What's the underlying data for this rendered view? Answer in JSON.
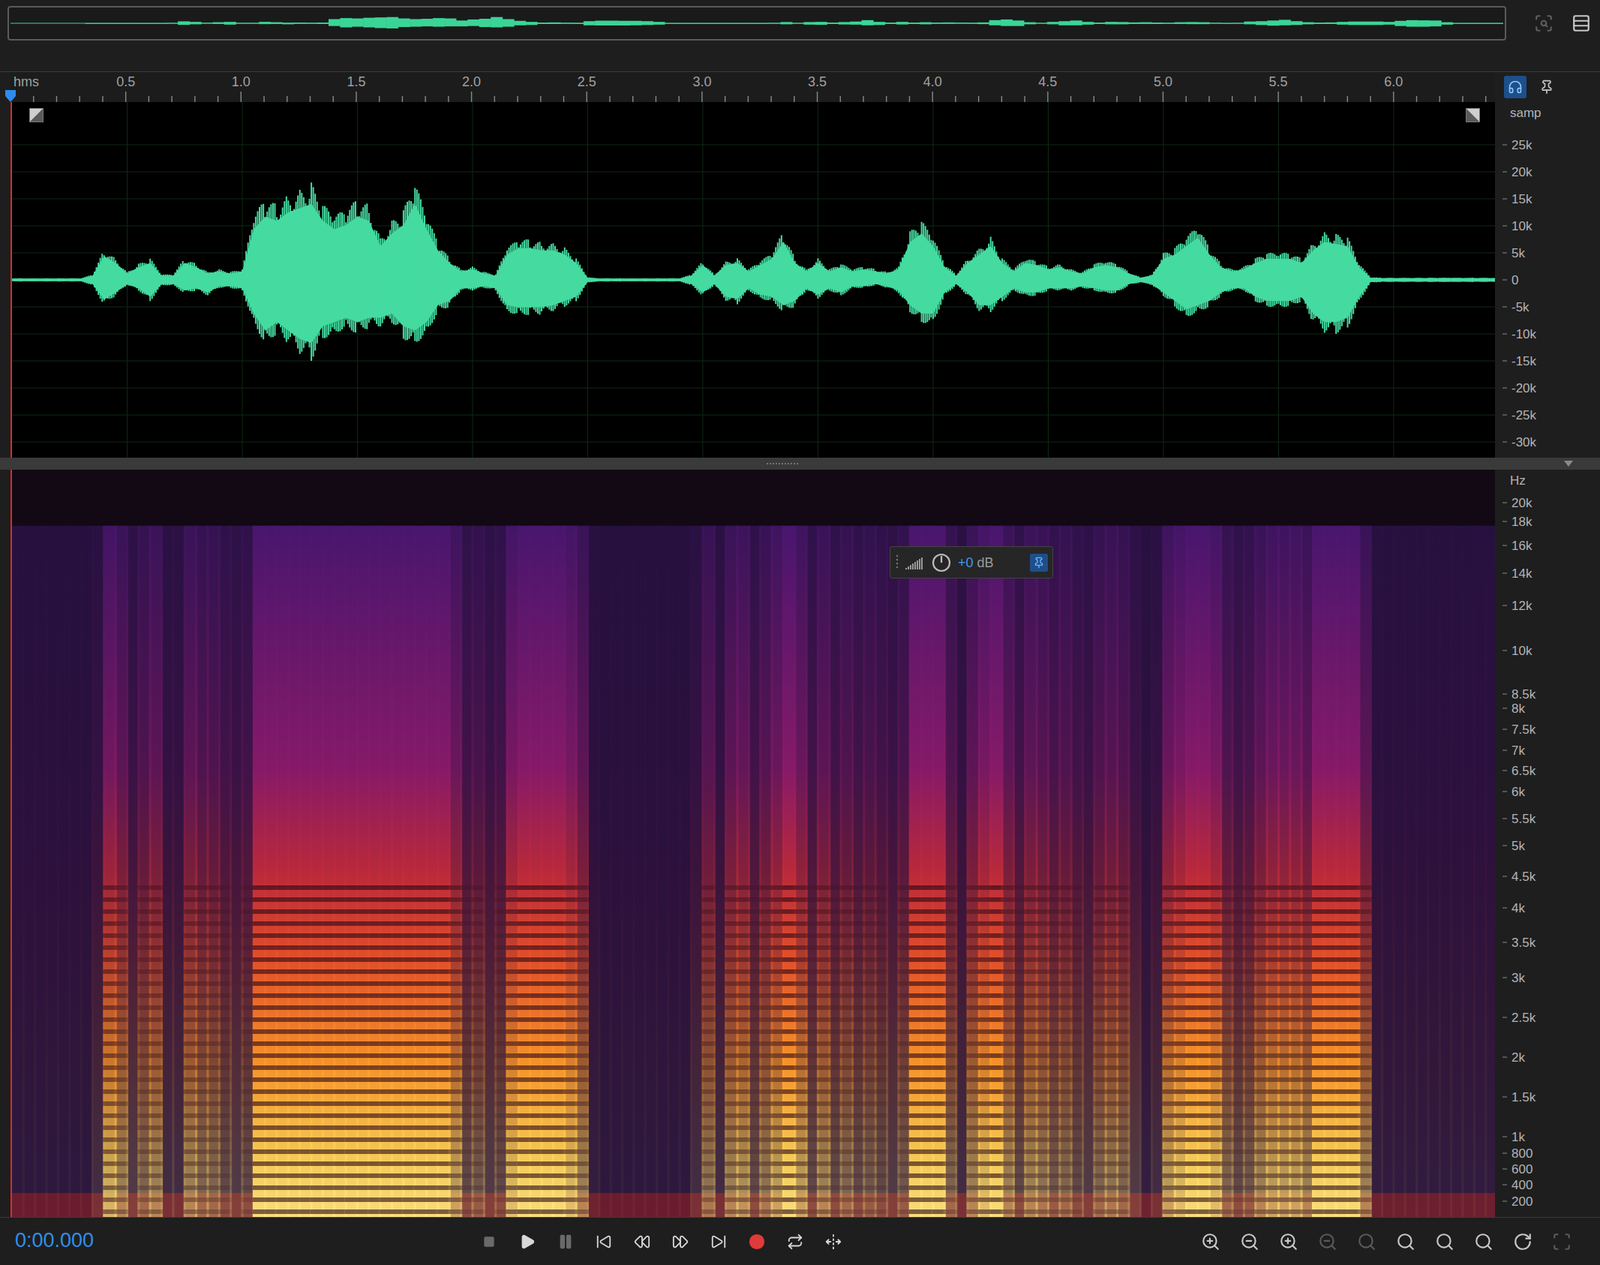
{
  "overview_tools": [
    {
      "kind": "zoom-navigator",
      "disabled": true
    },
    {
      "kind": "panel-menu",
      "disabled": false
    }
  ],
  "ruler": {
    "unit": "hms",
    "ticks": [
      "0.5",
      "1.0",
      "1.5",
      "2.0",
      "2.5",
      "3.0",
      "3.5",
      "4.0",
      "4.5",
      "5.0",
      "5.5",
      "6.0"
    ]
  },
  "ruler_tools": [
    {
      "kind": "headphones",
      "selected": true
    },
    {
      "kind": "pin",
      "selected": false
    }
  ],
  "waveform": {
    "axis_unit": "samp",
    "axis_ticks": [
      "25k",
      "20k",
      "15k",
      "10k",
      "5k",
      "0",
      "-5k",
      "-10k",
      "-15k",
      "-20k",
      "-25k",
      "-30k"
    ],
    "max": [
      300,
      300,
      300,
      300,
      300,
      300,
      300,
      1000,
      5600,
      4000,
      1500,
      3000,
      4000,
      1000,
      1000,
      4000,
      3000,
      1500,
      2000,
      1500,
      2000,
      12000,
      15000,
      14000,
      16000,
      17000,
      18000,
      14000,
      12000,
      13000,
      15000,
      14000,
      8000,
      11000,
      13000,
      18000,
      12000,
      7000,
      4000,
      2000,
      2500,
      1500,
      1000,
      6000,
      7500,
      7500,
      7000,
      7000,
      6000,
      4000,
      500,
      300,
      300,
      300,
      300,
      300,
      300,
      300,
      300,
      1000,
      3500,
      1000,
      3500,
      4000,
      2000,
      3500,
      5000,
      9000,
      4000,
      2000,
      4000,
      2000,
      3000,
      2000,
      2500,
      2000,
      1500,
      2500,
      9000,
      11000,
      8000,
      3000,
      1000,
      4000,
      6000,
      8000,
      4000,
      2000,
      4000,
      3500,
      2500,
      3000,
      2000,
      1500,
      3000,
      3500,
      3000,
      1500,
      500,
      1000,
      5000,
      6000,
      8000,
      10000,
      6000,
      3000,
      2000,
      2500,
      4000,
      5000,
      5000,
      5000,
      4000,
      7000,
      9000,
      8500,
      8000,
      3000,
      500,
      400,
      400,
      400,
      400,
      400,
      400,
      400,
      400,
      400,
      400
    ],
    "min": [
      -300,
      -300,
      -300,
      -300,
      -300,
      -300,
      -300,
      -1000,
      -4700,
      -3000,
      -1000,
      -2000,
      -4000,
      -1000,
      -1000,
      -2500,
      -2000,
      -3000,
      -1500,
      -1500,
      -2000,
      -8000,
      -12000,
      -10000,
      -12000,
      -14000,
      -15000,
      -11000,
      -10000,
      -9000,
      -10000,
      -9000,
      -9000,
      -8000,
      -11000,
      -12000,
      -10000,
      -6000,
      -5000,
      -2000,
      -2000,
      -1500,
      -2000,
      -6000,
      -6500,
      -6500,
      -6500,
      -6000,
      -5000,
      -4000,
      -500,
      -300,
      -300,
      -300,
      -300,
      -300,
      -300,
      -300,
      -300,
      -1000,
      -3000,
      -1000,
      -4000,
      -4500,
      -2000,
      -3500,
      -4000,
      -6000,
      -5000,
      -2000,
      -3500,
      -2000,
      -3000,
      -1500,
      -1500,
      -1000,
      -1500,
      -2500,
      -6000,
      -8000,
      -8000,
      -3000,
      -1000,
      -3000,
      -6000,
      -6000,
      -4000,
      -2000,
      -3000,
      -3000,
      -2000,
      -2000,
      -2000,
      -1500,
      -2000,
      -2500,
      -2500,
      -1000,
      -500,
      -1000,
      -3000,
      -5000,
      -7000,
      -6000,
      -5000,
      -3000,
      -2000,
      -2000,
      -4000,
      -5000,
      -5000,
      -5000,
      -4000,
      -8000,
      -10000,
      -10000,
      -9000,
      -4000,
      -500,
      -400,
      -400,
      -400,
      -400,
      -400,
      -400,
      -400,
      -400,
      -400,
      -400
    ]
  },
  "spectrogram": {
    "axis_unit": "Hz",
    "axis_ticks": [
      "20k",
      "18k",
      "16k",
      "14k",
      "12k",
      "10k",
      "8.5k",
      "8k",
      "7.5k",
      "7k",
      "6.5k",
      "6k",
      "5.5k",
      "5k",
      "4.5k",
      "4k",
      "3.5k",
      "3k",
      "2.5k",
      "2k",
      "1.5k",
      "1k",
      "800",
      "600",
      "400",
      "200"
    ]
  },
  "hud": {
    "value": "+0",
    "unit": "dB",
    "pinned": true
  },
  "time_display": "0:00.000",
  "transport": [
    {
      "kind": "stop",
      "disabled": true
    },
    {
      "kind": "play",
      "disabled": false
    },
    {
      "kind": "pause",
      "disabled": true
    },
    {
      "kind": "skip-back",
      "disabled": false
    },
    {
      "kind": "rewind",
      "disabled": false
    },
    {
      "kind": "fast-forward",
      "disabled": false
    },
    {
      "kind": "skip-forward",
      "disabled": false
    },
    {
      "kind": "record",
      "disabled": false
    },
    {
      "kind": "loop",
      "disabled": false
    },
    {
      "kind": "skip-selection",
      "disabled": false
    }
  ],
  "zoom_tools": [
    {
      "kind": "zoom-in-amplitude",
      "disabled": false
    },
    {
      "kind": "zoom-out-amplitude",
      "disabled": false
    },
    {
      "kind": "zoom-in-time",
      "disabled": false
    },
    {
      "kind": "zoom-out-full",
      "disabled": true
    },
    {
      "kind": "zoom-selection",
      "disabled": true
    },
    {
      "kind": "zoom-in-left",
      "disabled": false
    },
    {
      "kind": "zoom-in-right",
      "disabled": false
    },
    {
      "kind": "zoom-in-both",
      "disabled": false
    },
    {
      "kind": "zoom-playhead",
      "disabled": false
    },
    {
      "kind": "zoom-reset",
      "disabled": true
    }
  ]
}
